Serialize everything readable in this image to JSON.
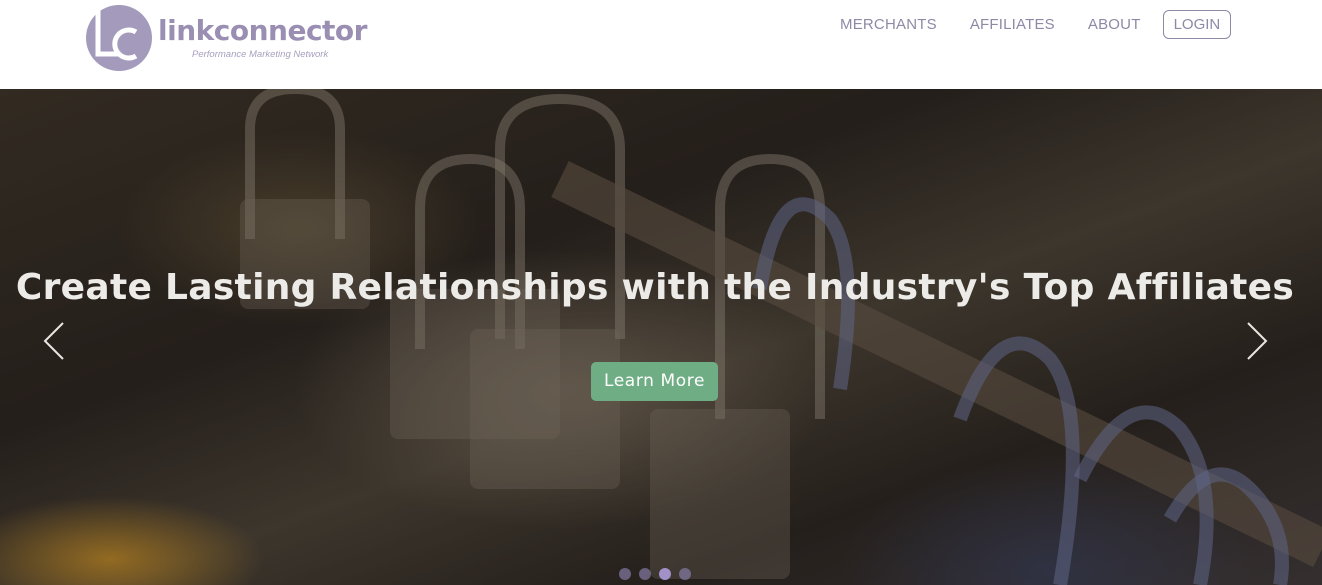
{
  "header": {
    "logo": {
      "wordmark": "linkconnector",
      "tagline": "Performance Marketing Network",
      "monogram": "LC",
      "color": "#9a8fb3"
    },
    "nav": [
      {
        "label": "MERCHANTS"
      },
      {
        "label": "AFFILIATES"
      },
      {
        "label": "ABOUT"
      }
    ],
    "login_label": "LOGIN",
    "nav_color": "#8f88a6"
  },
  "hero": {
    "headline": "Create Lasting Relationships with the Industry's Top Affiliates",
    "cta_label": "Learn More",
    "cta_color": "#6fae84",
    "prev_icon": "chevron-left-icon",
    "next_icon": "chevron-right-icon",
    "carousel": {
      "slide_count": 4,
      "active_index": 2
    }
  }
}
